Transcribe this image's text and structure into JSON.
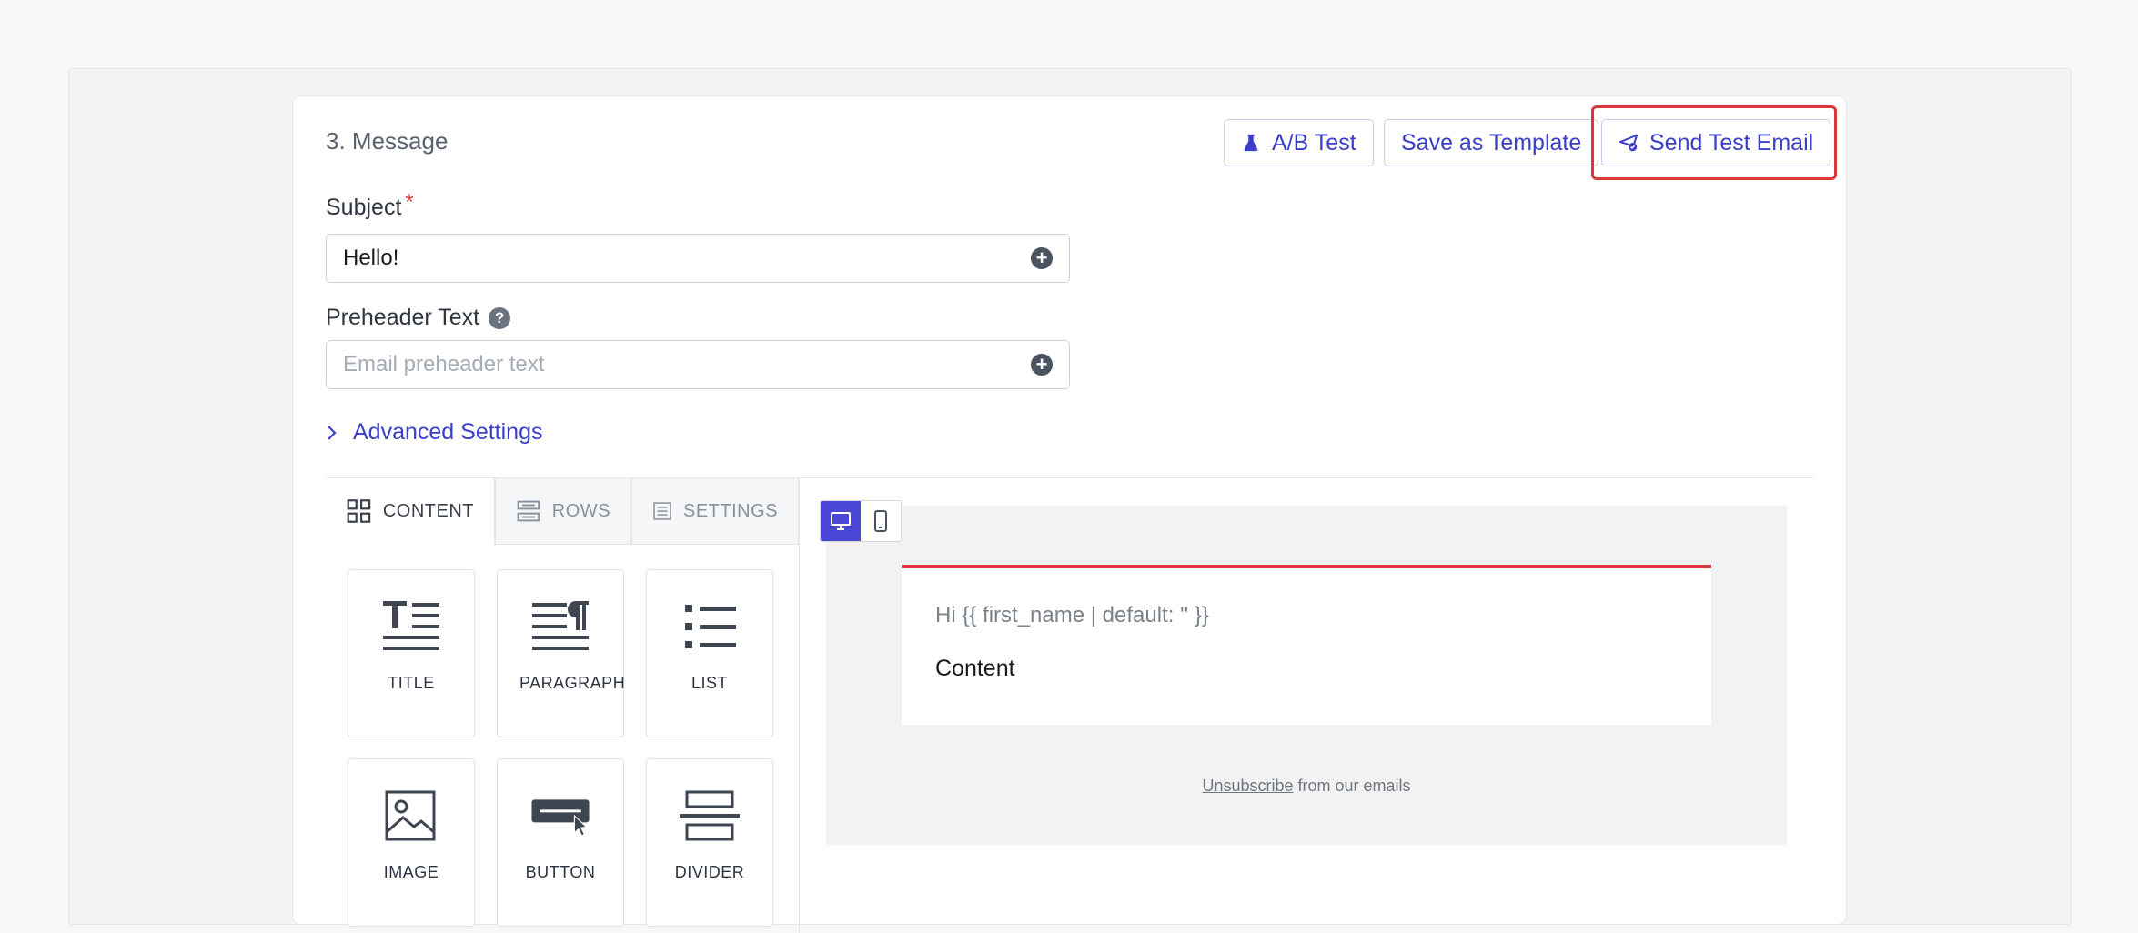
{
  "section": {
    "title": "3. Message"
  },
  "actions": {
    "ab_test": "A/B Test",
    "save_template": "Save as Template",
    "send_test": "Send Test Email"
  },
  "subject": {
    "label": "Subject",
    "required_mark": "*",
    "value": "Hello!"
  },
  "preheader": {
    "label": "Preheader Text",
    "help": "?",
    "placeholder": "Email preheader text"
  },
  "advanced": {
    "label": "Advanced Settings"
  },
  "editor": {
    "tabs": [
      {
        "label": "CONTENT",
        "icon": "grid-icon",
        "active": true
      },
      {
        "label": "ROWS",
        "icon": "rows-icon",
        "active": false
      },
      {
        "label": "SETTINGS",
        "icon": "settings-icon",
        "active": false
      }
    ],
    "blocks": [
      {
        "label": "TITLE",
        "icon": "title-icon"
      },
      {
        "label": "PARAGRAPH",
        "icon": "paragraph-icon"
      },
      {
        "label": "LIST",
        "icon": "list-icon"
      },
      {
        "label": "IMAGE",
        "icon": "image-icon"
      },
      {
        "label": "BUTTON",
        "icon": "button-icon"
      },
      {
        "label": "DIVIDER",
        "icon": "divider-icon"
      }
    ]
  },
  "preview": {
    "greeting": "Hi {{ first_name | default: '' }}",
    "content": "Content",
    "unsubscribe_link": "Unsubscribe",
    "unsubscribe_rest": " from our emails",
    "accent_color": "#dc3a3a",
    "active_device": "desktop"
  }
}
